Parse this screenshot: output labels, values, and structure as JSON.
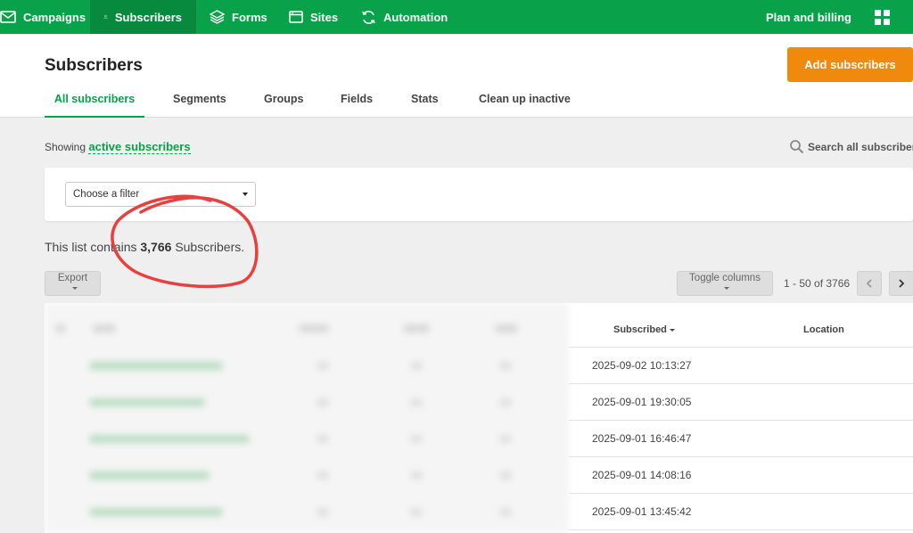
{
  "nav": {
    "items": [
      {
        "label": "Campaigns",
        "icon": "envelope-icon"
      },
      {
        "label": "Subscribers",
        "icon": "user-icon",
        "active": true
      },
      {
        "label": "Forms",
        "icon": "layers-icon"
      },
      {
        "label": "Sites",
        "icon": "browser-window-icon"
      },
      {
        "label": "Automation",
        "icon": "refresh-icon"
      }
    ],
    "billing": "Plan and billing",
    "apps_icon": "grid-icon"
  },
  "header": {
    "title": "Subscribers",
    "add_button": "Add subscribers",
    "tabs": [
      "All subscribers",
      "Segments",
      "Groups",
      "Fields",
      "Stats",
      "Clean up inactive"
    ],
    "active_tab": "All subscribers"
  },
  "showing": {
    "prefix": "Showing",
    "link": "active subscribers"
  },
  "search_all": "Search all subscribers",
  "filter": {
    "selected": "Choose a filter"
  },
  "list_count": {
    "prefix": "This list contains",
    "count": "3,766",
    "suffix": "Subscribers."
  },
  "toolbar": {
    "export": "Export",
    "toggle_columns": "Toggle columns",
    "pagination": "1 - 50 of 3766"
  },
  "table": {
    "columns": {
      "subscribed": "Subscribed",
      "location": "Location"
    },
    "rows": [
      {
        "subscribed": "2025-09-02 10:13:27"
      },
      {
        "subscribed": "2025-09-01 19:30:05"
      },
      {
        "subscribed": "2025-09-01 16:46:47"
      },
      {
        "subscribed": "2025-09-01 14:08:16"
      },
      {
        "subscribed": "2025-09-01 13:45:42"
      }
    ]
  },
  "colors": {
    "brand_green": "#09a24a",
    "accent_orange": "#f08a0c",
    "annotation_red": "#e8403e"
  }
}
